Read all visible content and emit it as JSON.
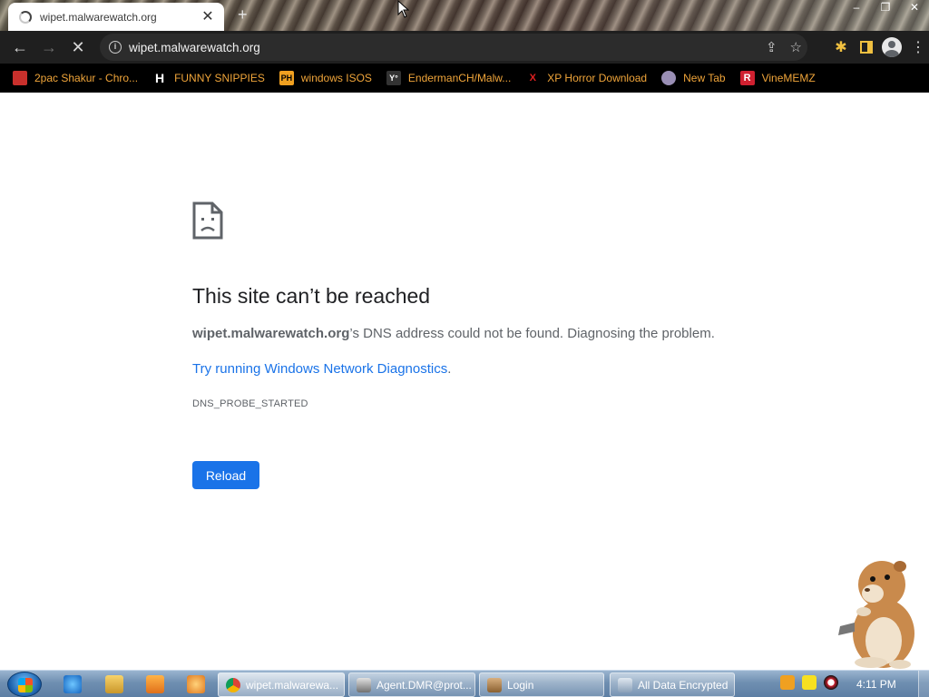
{
  "tab": {
    "title": "wipet.malwarewatch.org",
    "close": "✕"
  },
  "new_tab": "+",
  "window_controls": {
    "minimize": "–",
    "maximize": "❐",
    "close": "✕"
  },
  "toolbar": {
    "back": "←",
    "forward": "→",
    "stop": "✕",
    "url": "wipet.malwarewatch.org",
    "share": "⇪",
    "bookmark_star": "☆",
    "extensions": "✱",
    "menu": "⋮"
  },
  "bookmarks": [
    {
      "label": "2pac Shakur - Chro...",
      "icon": "gift-icon",
      "color": "#c9302c"
    },
    {
      "label": "FUNNY SNIPPIES",
      "icon": "h-icon",
      "glyph": "H",
      "color": "#ffffff"
    },
    {
      "label": "windows ISOS",
      "icon": "ph-icon",
      "glyph": "PH",
      "color": "#f0a020"
    },
    {
      "label": "EndermanCH/Malw...",
      "icon": "yp-icon",
      "glyph": "Y°",
      "color": "#333333"
    },
    {
      "label": "XP Horror Download",
      "icon": "x-icon",
      "glyph": "X",
      "color": "#e02020"
    },
    {
      "label": "New Tab",
      "icon": "globe-icon",
      "color": "#9a8fb5"
    },
    {
      "label": "VineMEMZ",
      "icon": "r-icon",
      "glyph": "R",
      "color": "#d02030"
    }
  ],
  "error_page": {
    "title": "This site can’t be reached",
    "host": "wipet.malwarewatch.org",
    "message_rest": "’s DNS address could not be found. Diagnosing the problem.",
    "link_prefix": "Try running ",
    "link_text": "Windows Network Diagnostics",
    "link_suffix": ".",
    "error_code": "DNS_PROBE_STARTED",
    "reload_label": "Reload"
  },
  "taskbar": {
    "buttons": [
      {
        "label": "wipet.malwarewa...",
        "icon": "chrome-icon",
        "active": true
      },
      {
        "label": "Agent.DMR@prot...",
        "icon": "terminal-icon",
        "active": false
      },
      {
        "label": "Login",
        "icon": "login-icon",
        "active": false
      },
      {
        "label": "All Data Encrypted",
        "icon": "window-icon",
        "active": false
      }
    ],
    "clock": "4:11 PM"
  },
  "colors": {
    "accent": "#1a73e8",
    "bookmark_text": "#f0a53a",
    "toolbar_bg": "#1f1f1f"
  }
}
